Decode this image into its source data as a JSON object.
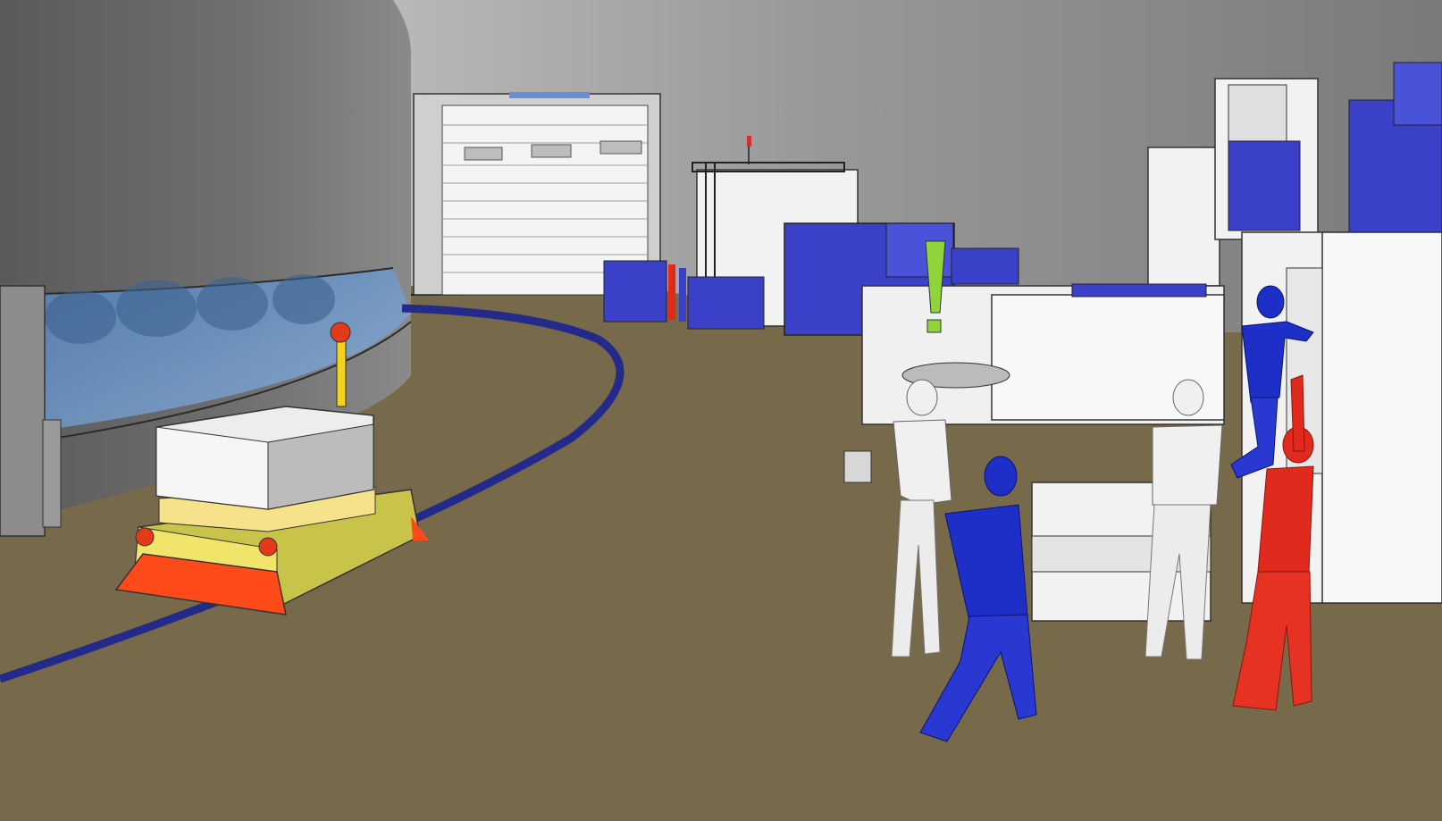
{
  "scene": {
    "description_visible_text": [],
    "colors": {
      "floor": "#776a4b",
      "wall_top": "#7f7f7f",
      "wall_light": "#c9c9c9",
      "tank": "#6f6f6f",
      "glass": "#6f98c8",
      "track": "#2a2f8c",
      "agv_body": "#c8c44a",
      "agv_front": "#ff4a1a",
      "pallet": "#f5e28a",
      "load_box": "#e6e6e6",
      "machine_blue": "#3a40c8",
      "machine_white": "#f2f2f2",
      "worker_white": "#f0f0f0",
      "worker_blue": "#1e2fc8",
      "worker_red": "#e02a1e",
      "beacon": "#f5d21a",
      "warning_green": "#8ed43a"
    }
  }
}
